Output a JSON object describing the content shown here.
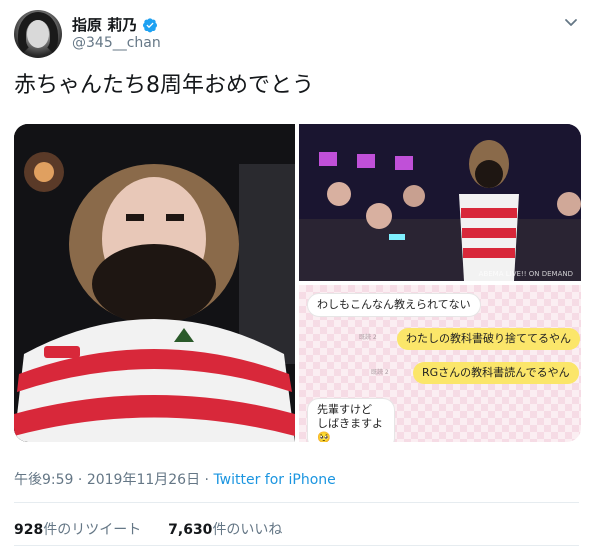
{
  "user": {
    "display_name": "指原 莉乃",
    "handle": "@345__chan",
    "verified": true
  },
  "tweet": {
    "text": "赤ちゃんたち8周年おめでとう"
  },
  "media": {
    "top_right_watermark": "ABEMA LIVE!! ON DEMAND",
    "chat": {
      "msg1": "わしもこんなん教えられてない",
      "msg2": "わたしの教科書破り捨ててるやん",
      "msg3": "RGさんの教科書読んでるやん",
      "msg4_line1": "先輩すけど",
      "msg4_line2": "しばきますよ🥺",
      "read_label": "既読 2"
    }
  },
  "meta": {
    "time": "午後9:59",
    "separator": "·",
    "date": "2019年11月26日",
    "source": "Twitter for iPhone"
  },
  "stats": {
    "retweet_count": "928",
    "retweet_label": "件のリツイート",
    "like_count": "7,630",
    "like_label": "件のいいね"
  },
  "colors": {
    "accent": "#1da1f2",
    "text_secondary": "#657786",
    "bubble_yellow": "#fbe66a"
  }
}
